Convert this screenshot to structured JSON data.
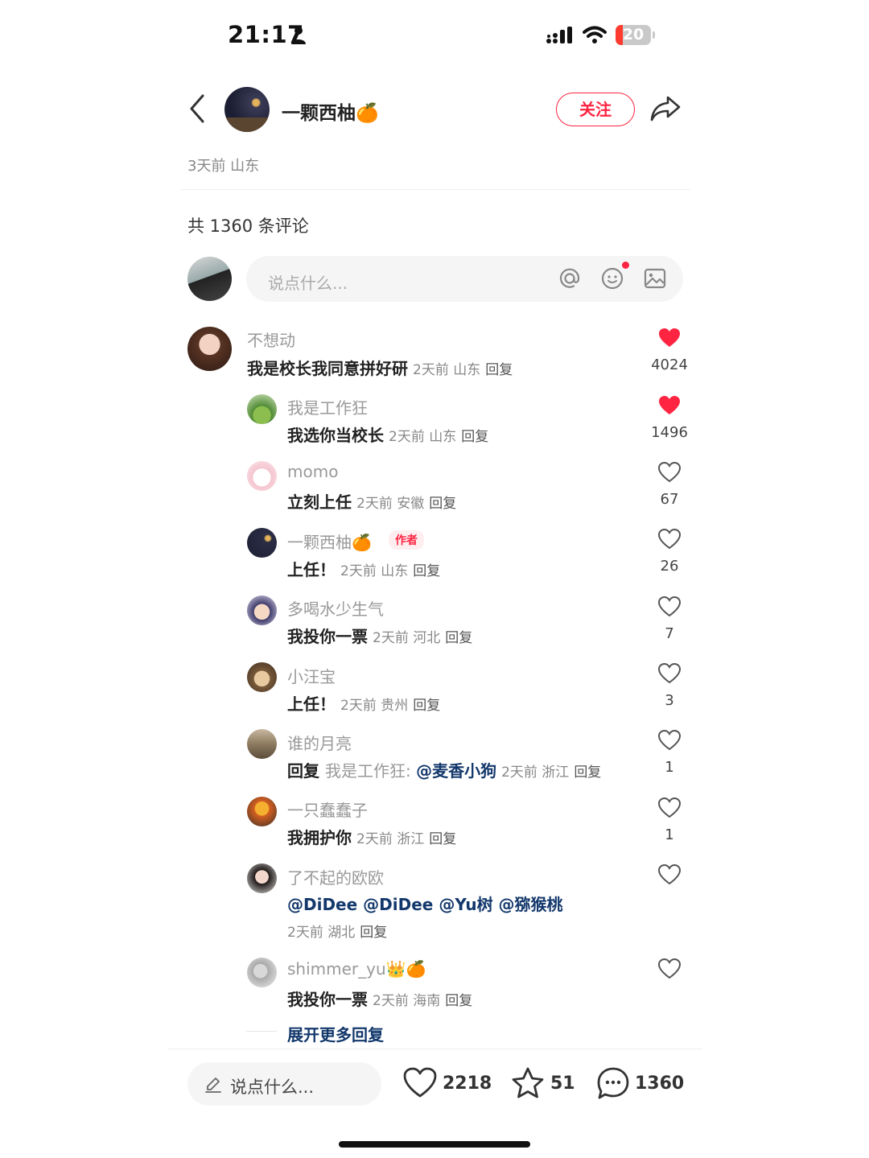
{
  "status_bar": {
    "time": "21:17",
    "battery": "20",
    "battery_level": 0.2
  },
  "header": {
    "author_name": "一颗西柚🍊",
    "follow_label": "关注"
  },
  "post": {
    "meta": "3天前 山东"
  },
  "comments_header": {
    "count_text": "共 1360 条评论"
  },
  "input": {
    "placeholder": "说点什么..."
  },
  "comments": [
    {
      "user": "不想动",
      "text": "我是校长我同意拼好研",
      "meta": "2天前 山东",
      "reply": "回复",
      "likes": "4024",
      "liked": true
    },
    {
      "user": "我是工作狂",
      "text": "我选你当校长",
      "meta": "2天前 山东",
      "reply": "回复",
      "likes": "1496",
      "liked": true
    },
    {
      "user": "momo",
      "text": "立刻上任",
      "meta": "2天前 安徽",
      "reply": "回复",
      "likes": "67",
      "liked": false
    },
    {
      "user": "一颗西柚🍊",
      "tag": "作者",
      "text": "上任！",
      "meta": "2天前 山东",
      "reply": "回复",
      "likes": "26",
      "liked": false
    },
    {
      "user": "多喝水少生气",
      "text": "我投你一票",
      "meta": "2天前 河北",
      "reply": "回复",
      "likes": "7",
      "liked": false
    },
    {
      "user": "小汪宝",
      "text": "上任！",
      "meta": "2天前 贵州",
      "reply": "回复",
      "likes": "3",
      "liked": false
    },
    {
      "user": "谁的月亮",
      "text_prefix": "回复",
      "reply_to": "我是工作狂:",
      "mention": "@麦香小狗",
      "meta": "2天前 浙江",
      "reply": "回复",
      "likes": "1",
      "liked": false
    },
    {
      "user": "一只蠢蠢子",
      "text": "我拥护你",
      "meta": "2天前 浙江",
      "reply": "回复",
      "likes": "1",
      "liked": false
    },
    {
      "user": "了不起的欧欧",
      "mentions": [
        "@DiDee",
        "@DiDee",
        "@Yu树",
        "@猕猴桃"
      ],
      "meta": "2天前 湖北",
      "reply": "回复",
      "liked": false
    },
    {
      "user": "shimmer_yu👑🍊",
      "text": "我投你一票",
      "meta": "2天前 海南",
      "reply": "回复",
      "liked": false
    }
  ],
  "expand_label": "展开更多回复",
  "bottom_bar": {
    "placeholder": "说点什么...",
    "likes": "2218",
    "favorites": "51",
    "comments": "1360"
  },
  "colors": {
    "accent": "#ff2442",
    "mention": "#13386c"
  }
}
